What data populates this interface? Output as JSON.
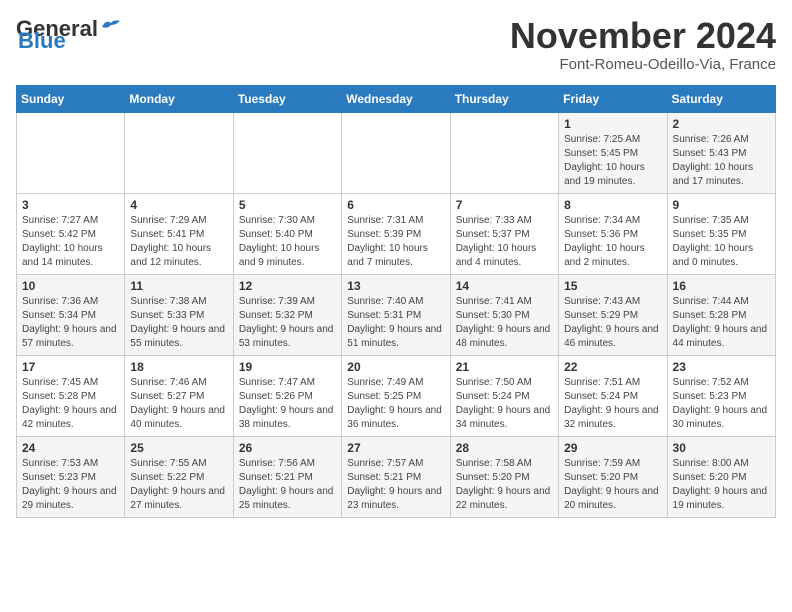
{
  "header": {
    "logo_general": "General",
    "logo_blue": "Blue",
    "month_title": "November 2024",
    "location": "Font-Romeu-Odeillo-Via, France"
  },
  "weekdays": [
    "Sunday",
    "Monday",
    "Tuesday",
    "Wednesday",
    "Thursday",
    "Friday",
    "Saturday"
  ],
  "weeks": [
    [
      {
        "day": "",
        "info": ""
      },
      {
        "day": "",
        "info": ""
      },
      {
        "day": "",
        "info": ""
      },
      {
        "day": "",
        "info": ""
      },
      {
        "day": "",
        "info": ""
      },
      {
        "day": "1",
        "info": "Sunrise: 7:25 AM\nSunset: 5:45 PM\nDaylight: 10 hours and 19 minutes."
      },
      {
        "day": "2",
        "info": "Sunrise: 7:26 AM\nSunset: 5:43 PM\nDaylight: 10 hours and 17 minutes."
      }
    ],
    [
      {
        "day": "3",
        "info": "Sunrise: 7:27 AM\nSunset: 5:42 PM\nDaylight: 10 hours and 14 minutes."
      },
      {
        "day": "4",
        "info": "Sunrise: 7:29 AM\nSunset: 5:41 PM\nDaylight: 10 hours and 12 minutes."
      },
      {
        "day": "5",
        "info": "Sunrise: 7:30 AM\nSunset: 5:40 PM\nDaylight: 10 hours and 9 minutes."
      },
      {
        "day": "6",
        "info": "Sunrise: 7:31 AM\nSunset: 5:39 PM\nDaylight: 10 hours and 7 minutes."
      },
      {
        "day": "7",
        "info": "Sunrise: 7:33 AM\nSunset: 5:37 PM\nDaylight: 10 hours and 4 minutes."
      },
      {
        "day": "8",
        "info": "Sunrise: 7:34 AM\nSunset: 5:36 PM\nDaylight: 10 hours and 2 minutes."
      },
      {
        "day": "9",
        "info": "Sunrise: 7:35 AM\nSunset: 5:35 PM\nDaylight: 10 hours and 0 minutes."
      }
    ],
    [
      {
        "day": "10",
        "info": "Sunrise: 7:36 AM\nSunset: 5:34 PM\nDaylight: 9 hours and 57 minutes."
      },
      {
        "day": "11",
        "info": "Sunrise: 7:38 AM\nSunset: 5:33 PM\nDaylight: 9 hours and 55 minutes."
      },
      {
        "day": "12",
        "info": "Sunrise: 7:39 AM\nSunset: 5:32 PM\nDaylight: 9 hours and 53 minutes."
      },
      {
        "day": "13",
        "info": "Sunrise: 7:40 AM\nSunset: 5:31 PM\nDaylight: 9 hours and 51 minutes."
      },
      {
        "day": "14",
        "info": "Sunrise: 7:41 AM\nSunset: 5:30 PM\nDaylight: 9 hours and 48 minutes."
      },
      {
        "day": "15",
        "info": "Sunrise: 7:43 AM\nSunset: 5:29 PM\nDaylight: 9 hours and 46 minutes."
      },
      {
        "day": "16",
        "info": "Sunrise: 7:44 AM\nSunset: 5:28 PM\nDaylight: 9 hours and 44 minutes."
      }
    ],
    [
      {
        "day": "17",
        "info": "Sunrise: 7:45 AM\nSunset: 5:28 PM\nDaylight: 9 hours and 42 minutes."
      },
      {
        "day": "18",
        "info": "Sunrise: 7:46 AM\nSunset: 5:27 PM\nDaylight: 9 hours and 40 minutes."
      },
      {
        "day": "19",
        "info": "Sunrise: 7:47 AM\nSunset: 5:26 PM\nDaylight: 9 hours and 38 minutes."
      },
      {
        "day": "20",
        "info": "Sunrise: 7:49 AM\nSunset: 5:25 PM\nDaylight: 9 hours and 36 minutes."
      },
      {
        "day": "21",
        "info": "Sunrise: 7:50 AM\nSunset: 5:24 PM\nDaylight: 9 hours and 34 minutes."
      },
      {
        "day": "22",
        "info": "Sunrise: 7:51 AM\nSunset: 5:24 PM\nDaylight: 9 hours and 32 minutes."
      },
      {
        "day": "23",
        "info": "Sunrise: 7:52 AM\nSunset: 5:23 PM\nDaylight: 9 hours and 30 minutes."
      }
    ],
    [
      {
        "day": "24",
        "info": "Sunrise: 7:53 AM\nSunset: 5:23 PM\nDaylight: 9 hours and 29 minutes."
      },
      {
        "day": "25",
        "info": "Sunrise: 7:55 AM\nSunset: 5:22 PM\nDaylight: 9 hours and 27 minutes."
      },
      {
        "day": "26",
        "info": "Sunrise: 7:56 AM\nSunset: 5:21 PM\nDaylight: 9 hours and 25 minutes."
      },
      {
        "day": "27",
        "info": "Sunrise: 7:57 AM\nSunset: 5:21 PM\nDaylight: 9 hours and 23 minutes."
      },
      {
        "day": "28",
        "info": "Sunrise: 7:58 AM\nSunset: 5:20 PM\nDaylight: 9 hours and 22 minutes."
      },
      {
        "day": "29",
        "info": "Sunrise: 7:59 AM\nSunset: 5:20 PM\nDaylight: 9 hours and 20 minutes."
      },
      {
        "day": "30",
        "info": "Sunrise: 8:00 AM\nSunset: 5:20 PM\nDaylight: 9 hours and 19 minutes."
      }
    ]
  ]
}
